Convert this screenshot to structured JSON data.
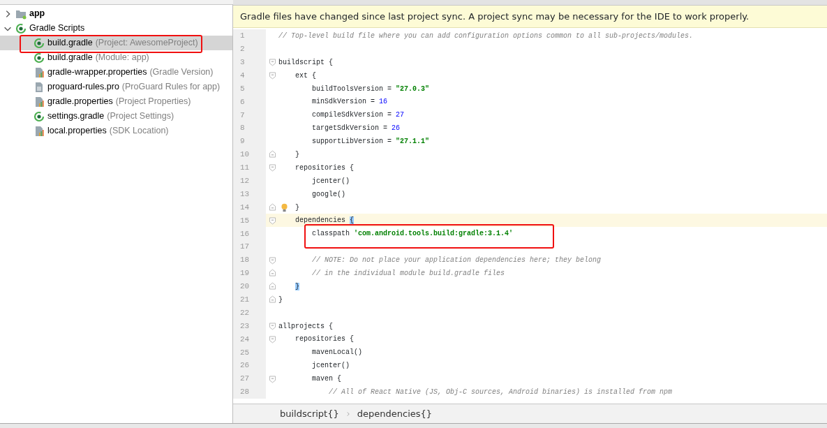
{
  "project_tree": [
    {
      "kind": "folder",
      "label": "app",
      "expanded": false,
      "selected": false
    },
    {
      "kind": "gradle",
      "label": "Gradle Scripts",
      "expanded": true,
      "selected": false,
      "children": [
        {
          "kind": "gradle",
          "label": "build.gradle",
          "hint": "(Project: AwesomeProject)",
          "selected": true,
          "highlighted": true
        },
        {
          "kind": "gradle",
          "label": "build.gradle",
          "hint": "(Module: app)",
          "selected": false
        },
        {
          "kind": "properties",
          "label": "gradle-wrapper.properties",
          "hint": "(Gradle Version)",
          "selected": false
        },
        {
          "kind": "text",
          "label": "proguard-rules.pro",
          "hint": "(ProGuard Rules for app)",
          "selected": false
        },
        {
          "kind": "properties",
          "label": "gradle.properties",
          "hint": "(Project Properties)",
          "selected": false
        },
        {
          "kind": "gradle",
          "label": "settings.gradle",
          "hint": "(Project Settings)",
          "selected": false
        },
        {
          "kind": "properties",
          "label": "local.properties",
          "hint": "(SDK Location)",
          "selected": false
        }
      ]
    }
  ],
  "notification": "Gradle files have changed since last project sync. A project sync may be necessary for the IDE to work properly.",
  "code_lines": [
    {
      "number": "1",
      "tokens": [
        {
          "kind": "comment",
          "text": "// Top-level build file where you can add configuration options common to all sub-projects/modules."
        }
      ]
    },
    {
      "number": "2"
    },
    {
      "number": "3",
      "fold_start": true,
      "tokens": [
        {
          "kind": "plain",
          "text": "buildscript {"
        }
      ]
    },
    {
      "number": "4",
      "fold_start": true,
      "tokens": [
        {
          "kind": "plain",
          "text": "    ext {"
        }
      ]
    },
    {
      "number": "5",
      "tokens": [
        {
          "kind": "plain",
          "text": "        buildToolsVersion = "
        },
        {
          "kind": "string",
          "text": "\"27.0.3\""
        }
      ]
    },
    {
      "number": "6",
      "tokens": [
        {
          "kind": "plain",
          "text": "        minSdkVersion = "
        },
        {
          "kind": "number",
          "text": "16"
        }
      ]
    },
    {
      "number": "7",
      "tokens": [
        {
          "kind": "plain",
          "text": "        compileSdkVersion = "
        },
        {
          "kind": "number",
          "text": "27"
        }
      ]
    },
    {
      "number": "8",
      "tokens": [
        {
          "kind": "plain",
          "text": "        targetSdkVersion = "
        },
        {
          "kind": "number",
          "text": "26"
        }
      ]
    },
    {
      "number": "9",
      "tokens": [
        {
          "kind": "plain",
          "text": "        supportLibVersion = "
        },
        {
          "kind": "string",
          "text": "\"27.1.1\""
        }
      ]
    },
    {
      "number": "10",
      "fold_end": true,
      "tokens": [
        {
          "kind": "plain",
          "text": "    }"
        }
      ]
    },
    {
      "number": "11",
      "fold_start": true,
      "tokens": [
        {
          "kind": "plain",
          "text": "    repositories {"
        }
      ]
    },
    {
      "number": "12",
      "tokens": [
        {
          "kind": "plain",
          "text": "        jcenter()"
        }
      ]
    },
    {
      "number": "13",
      "tokens": [
        {
          "kind": "plain",
          "text": "        google()"
        }
      ]
    },
    {
      "number": "14",
      "fold_end": true,
      "bulb": true,
      "tokens": [
        {
          "kind": "plain",
          "text": "    }"
        }
      ]
    },
    {
      "number": "15",
      "fold_start": true,
      "caret": true,
      "tokens": [
        {
          "kind": "plain",
          "text": "    dependencies "
        },
        {
          "kind": "brace_match",
          "text": "{"
        }
      ]
    },
    {
      "number": "16",
      "highlighted": true,
      "tokens": [
        {
          "kind": "plain",
          "text": "        classpath "
        },
        {
          "kind": "string",
          "text": "'com.android.tools.build:gradle:3.1.4'"
        }
      ]
    },
    {
      "number": "17"
    },
    {
      "number": "18",
      "fold_start": true,
      "tokens": [
        {
          "kind": "comment",
          "text": "        // NOTE: Do not place your application dependencies here; they belong"
        }
      ]
    },
    {
      "number": "19",
      "fold_end": true,
      "tokens": [
        {
          "kind": "comment",
          "text": "        // in the individual module build.gradle files"
        }
      ]
    },
    {
      "number": "20",
      "fold_end": true,
      "tokens": [
        {
          "kind": "brace_match",
          "text": "    }"
        }
      ]
    },
    {
      "number": "21",
      "fold_end": true,
      "tokens": [
        {
          "kind": "plain",
          "text": "}"
        }
      ]
    },
    {
      "number": "22"
    },
    {
      "number": "23",
      "fold_start": true,
      "tokens": [
        {
          "kind": "plain",
          "text": "allprojects {"
        }
      ]
    },
    {
      "number": "24",
      "fold_start": true,
      "tokens": [
        {
          "kind": "plain",
          "text": "    repositories {"
        }
      ]
    },
    {
      "number": "25",
      "tokens": [
        {
          "kind": "plain",
          "text": "        mavenLocal()"
        }
      ]
    },
    {
      "number": "26",
      "tokens": [
        {
          "kind": "plain",
          "text": "        jcenter()"
        }
      ]
    },
    {
      "number": "27",
      "fold_start": true,
      "tokens": [
        {
          "kind": "plain",
          "text": "        maven {"
        }
      ]
    },
    {
      "number": "28",
      "tokens": [
        {
          "kind": "comment",
          "text": "            // All of React Native (JS, Obj-C sources, Android binaries) is installed from npm"
        }
      ]
    }
  ],
  "breadcrumbs": [
    "buildscript{}",
    "dependencies{}"
  ]
}
